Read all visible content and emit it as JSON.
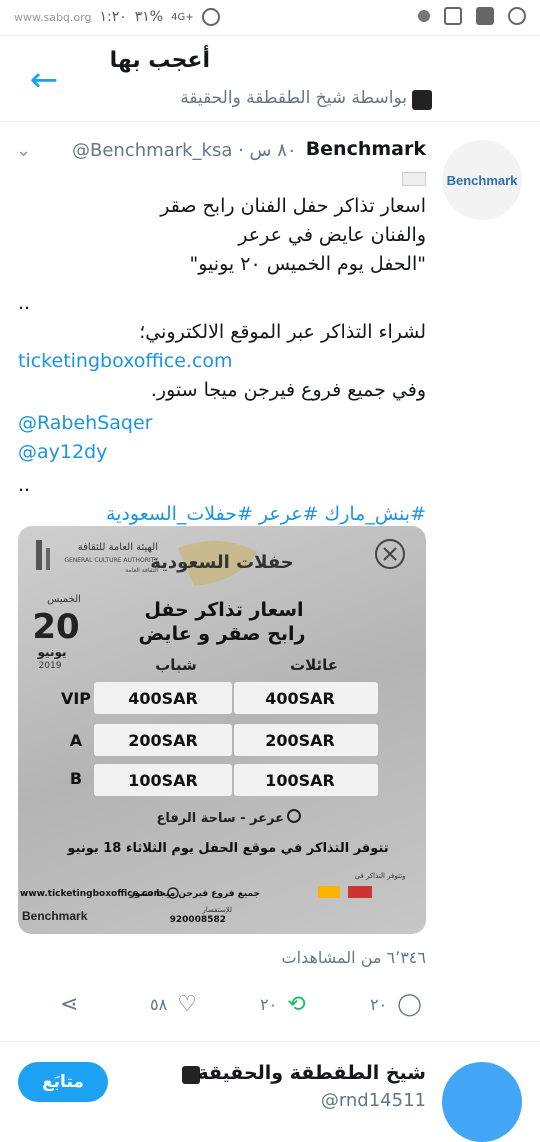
{
  "status_bar": {
    "carrier": "www.sabq.org",
    "battery": "٣١%",
    "network": "4G+",
    "time": "١:٢٠"
  },
  "header": {
    "title": "أعجب بها",
    "subtitle": "بواسطة شيخ الطقطقة والحقيقة"
  },
  "tweet": {
    "name": "Benchmark",
    "handle": "@Benchmark_ksa · ٨٠ س",
    "avatar_text": "Benchmark",
    "lines": [
      "اسعار تذاكر حفل الفنان رابح صقر",
      "والفنان عايض في عرعر",
      "\"الحفل يوم الخميس ٢٠ يونيو\"",
      "..",
      "لشراء التذاكر عبر الموقع الالكتروني؛",
      "ticketingboxoffice.com",
      "وفي جميع فروع فيرجن ميجا ستور.",
      "@RabehSaqer",
      "@ay12dy",
      "..",
      "#بنش_مارك #عرعر #حفلات_السعودية"
    ],
    "views": "٦٬٣٤٦ من المشاهدات",
    "actions": {
      "reply": "٢٠",
      "retweet": "٢٠",
      "like": "٥٨"
    }
  },
  "poster": {
    "authority_name": "الهيئة العامة للثقافة",
    "authority_en": "GENERAL CULTURE AUTHORITY",
    "authority_sub": "الثقافة العامة",
    "day": "الخميس",
    "date_num": "20",
    "month": "يونيو",
    "year": "2019",
    "logo_title": "حفلات السعودية",
    "heading1": "اسعار تذاكر حفل",
    "heading2": "رابح صقر و عايض",
    "col_youth": "شباب",
    "col_family": "عائلات",
    "rows": [
      {
        "label": "VIP",
        "youth": "400SAR",
        "family": "400SAR"
      },
      {
        "label": "A",
        "youth": "200SAR",
        "family": "200SAR"
      },
      {
        "label": "B",
        "youth": "100SAR",
        "family": "100SAR"
      }
    ],
    "location": "عرعر - ساحة الرفاع",
    "availability": "تتوفر التذاكر في موقع الحفل يوم  الثلاثاء 18 يونيو",
    "website": "www.ticketingboxoffice.com",
    "stores_label": "وتتوفر التذاكر في",
    "stores": "جميع فروع فيرجن ميجا ستور",
    "phone_label": "للإستفسار",
    "phone": "920008582",
    "brand": "Benchmark"
  },
  "suggestion": {
    "name": "شيخ الطقطقة والحقيقة",
    "handle": "@rnd14511",
    "follow_label": "متابَع"
  },
  "colors": {
    "accent": "#1da1f2",
    "text": "#14171a",
    "muted": "#657786",
    "retweet": "#17bf63"
  }
}
